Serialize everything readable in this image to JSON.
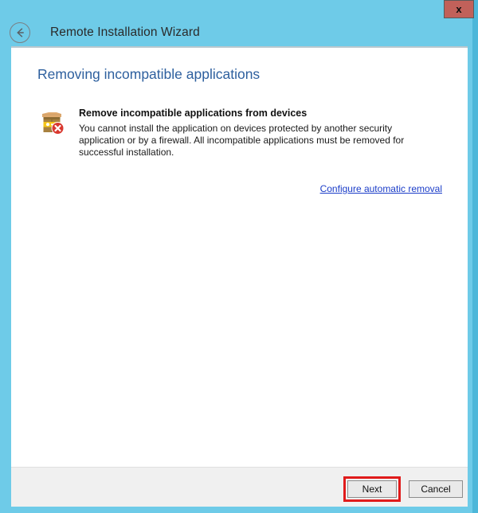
{
  "window": {
    "title": "Remote Installation Wizard",
    "back_icon": "back-arrow-circle-icon",
    "close_label": "x",
    "accent_background": "#6ecbe8",
    "close_button_color": "#c1615a"
  },
  "page": {
    "title": "Removing incompatible applications",
    "title_color": "#2d5f9e"
  },
  "content": {
    "icon": "incompatible-package-error-icon",
    "heading": "Remove incompatible applications from devices",
    "paragraph": "You cannot install the application on devices protected by another security application or by a firewall. All incompatible applications must be removed for successful installation.",
    "link_label": "Configure automatic removal",
    "link_color": "#1a3cc8"
  },
  "footer": {
    "next_label": "Next",
    "cancel_label": "Cancel",
    "highlight_color": "#e01b1b"
  }
}
